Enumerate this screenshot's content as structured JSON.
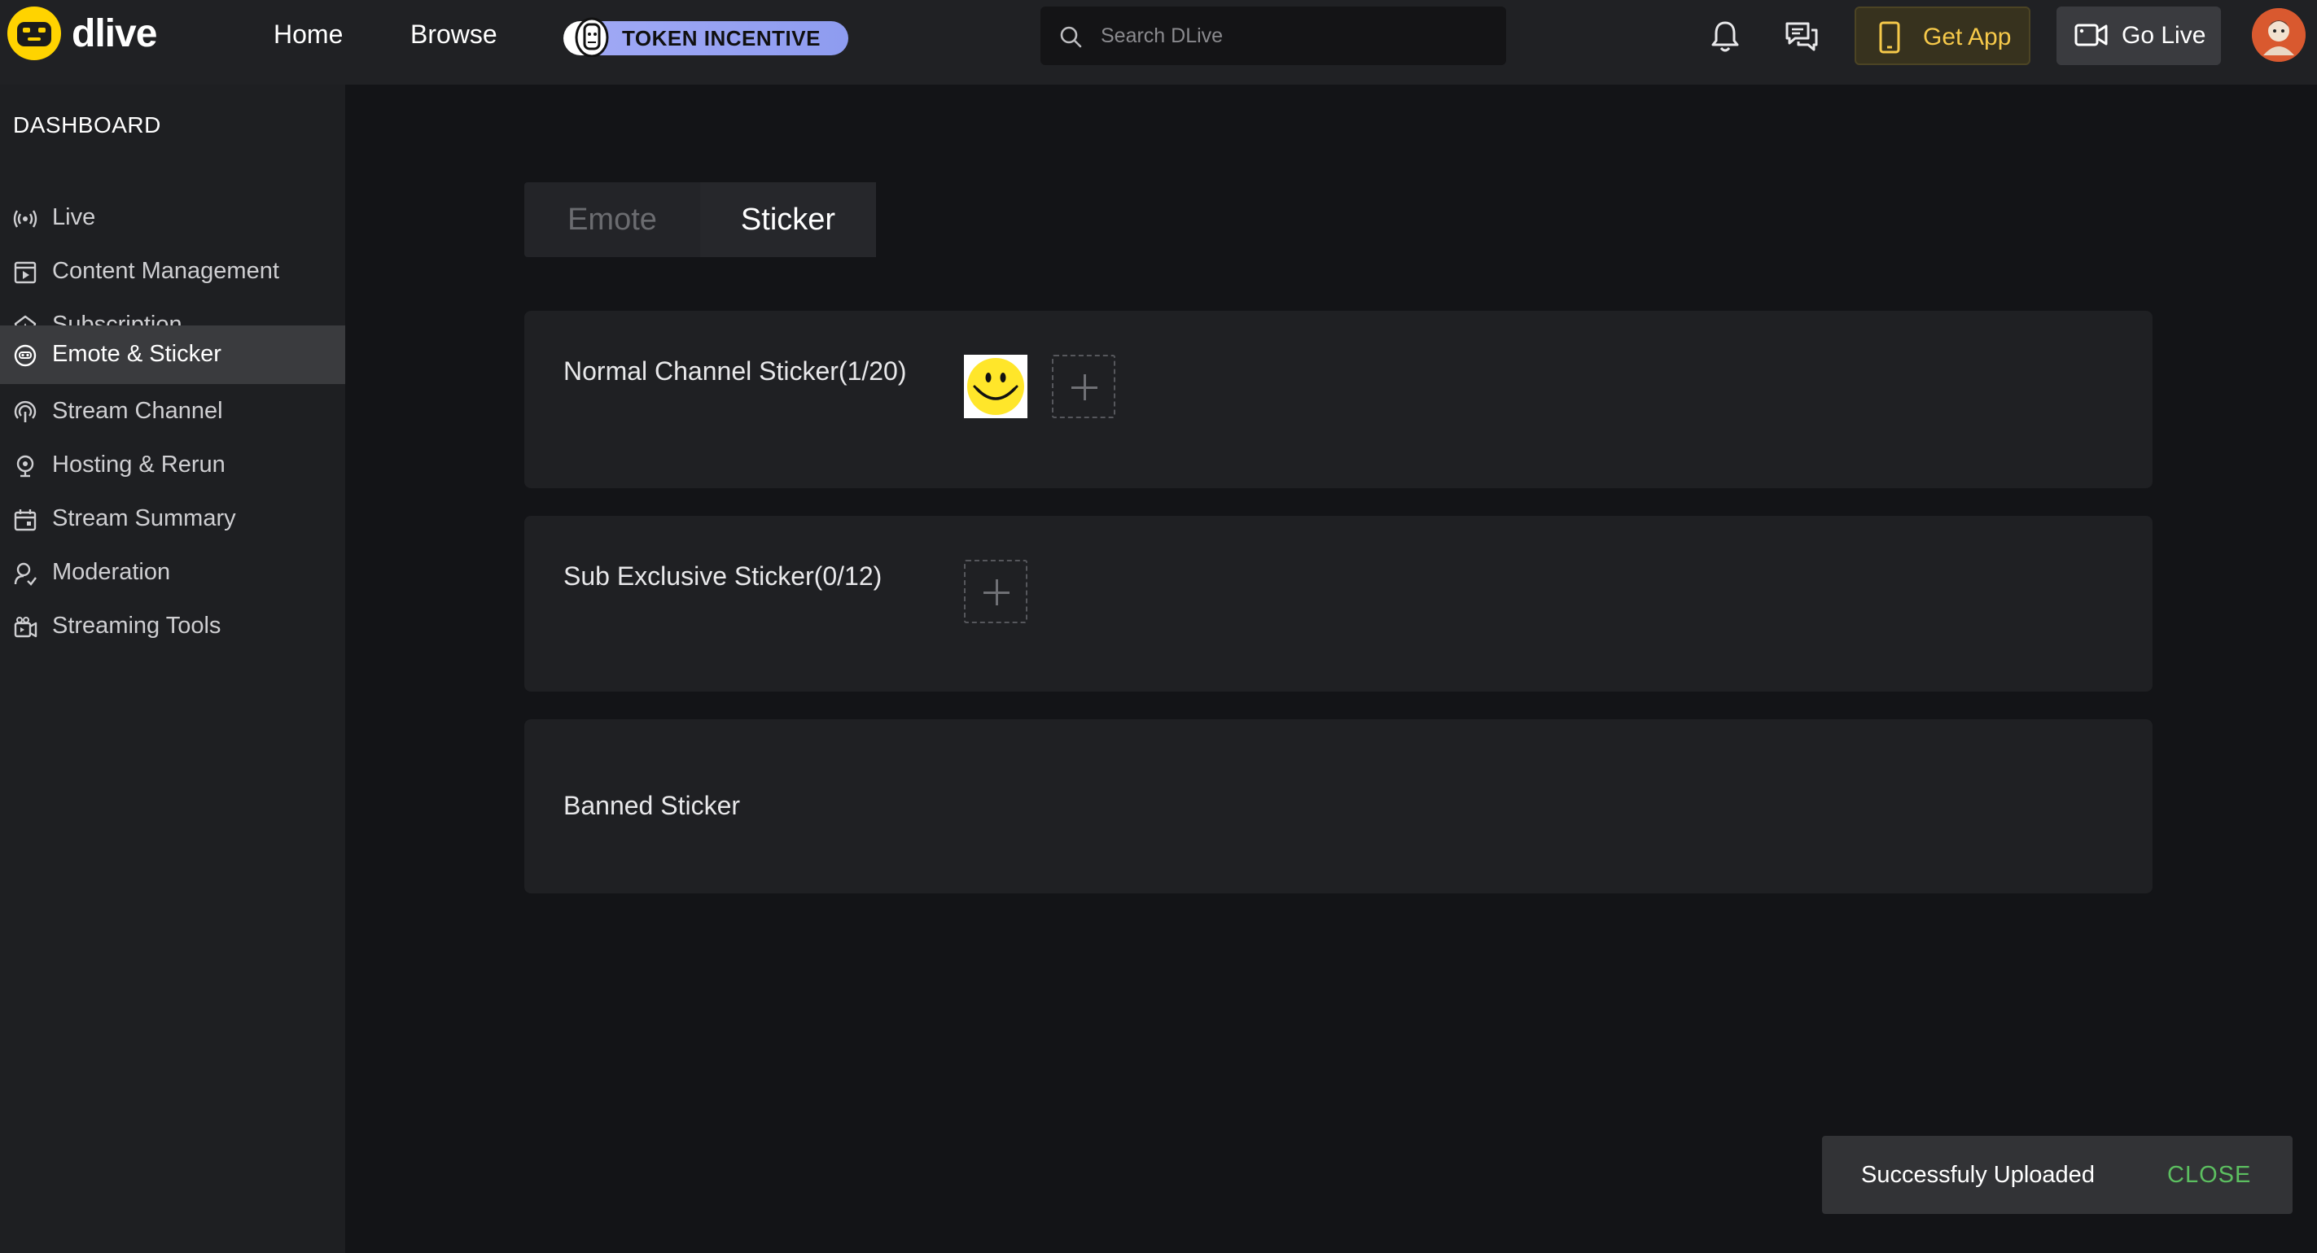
{
  "header": {
    "logo_text": "dlive",
    "nav": {
      "home": "Home",
      "browse": "Browse"
    },
    "token_badge": "TOKEN INCENTIVE",
    "search": {
      "placeholder": "Search DLive",
      "value": ""
    },
    "get_app": "Get App",
    "go_live": "Go Live"
  },
  "sidebar": {
    "title": "DASHBOARD",
    "items": [
      {
        "label": "Live",
        "icon": "live-broadcast-icon"
      },
      {
        "label": "Content Management",
        "icon": "content-icon"
      },
      {
        "label": "Subscription",
        "icon": "subscription-icon"
      },
      {
        "label": "Emote & Sticker",
        "icon": "emote-icon",
        "active": true
      },
      {
        "label": "Stream Channel",
        "icon": "stream-channel-icon"
      },
      {
        "label": "Hosting & Rerun",
        "icon": "hosting-icon"
      },
      {
        "label": "Stream Summary",
        "icon": "calendar-icon"
      },
      {
        "label": "Moderation",
        "icon": "moderation-icon"
      },
      {
        "label": "Streaming Tools",
        "icon": "streaming-tools-icon"
      }
    ]
  },
  "tabs": {
    "emote": "Emote",
    "sticker": "Sticker",
    "selected": "Sticker"
  },
  "panels": {
    "normal": {
      "title": "Normal Channel Sticker(1/20)"
    },
    "sub": {
      "title": "Sub Exclusive Sticker(0/12)"
    },
    "banned": {
      "title": "Banned Sticker"
    }
  },
  "toast": {
    "message": "Successfuly Uploaded",
    "close": "CLOSE"
  },
  "colors": {
    "accent_yellow": "#f6c94a",
    "toast_close_green": "#5cbf60",
    "background": "#131417",
    "sidebar_bg": "#1e1f22",
    "topbar_bg": "#202124"
  }
}
